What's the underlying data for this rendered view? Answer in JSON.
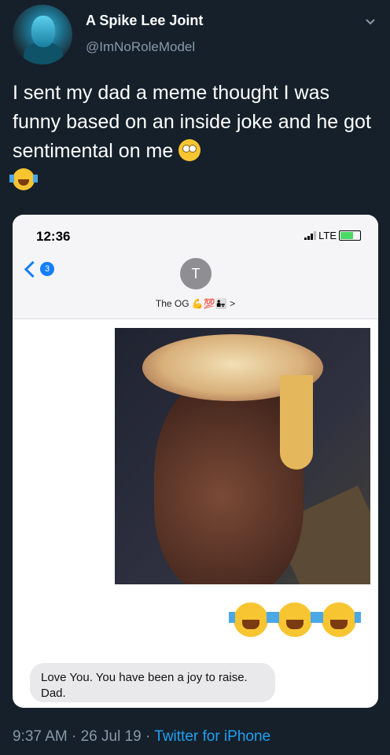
{
  "tweet": {
    "display_name": "A Spike Lee Joint",
    "handle": "@ImNoRoleModel",
    "text": "I sent my dad a meme thought I was funny based on an inside joke and he got sentimental on me",
    "emojis": [
      "face-with-rolling-eyes",
      "face-with-tears-of-joy"
    ]
  },
  "screenshot": {
    "status_time": "12:36",
    "carrier": "LTE",
    "back_count": "3",
    "contact_initial": "T",
    "contact_name": "The OG 💪💯👨‍👧 >",
    "reactions": [
      "face-with-tears-of-joy",
      "face-with-tears-of-joy",
      "face-with-tears-of-joy"
    ],
    "message_line1": "Love You. You have been a joy to raise.",
    "message_line2": "Dad."
  },
  "footer": {
    "time": "9:37 AM",
    "sep1": " · ",
    "date": "26 Jul 19",
    "sep2": " · ",
    "source": "Twitter for iPhone"
  },
  "colors": {
    "background": "#15202b",
    "link": "#1da1f2",
    "muted": "#8899a6"
  }
}
